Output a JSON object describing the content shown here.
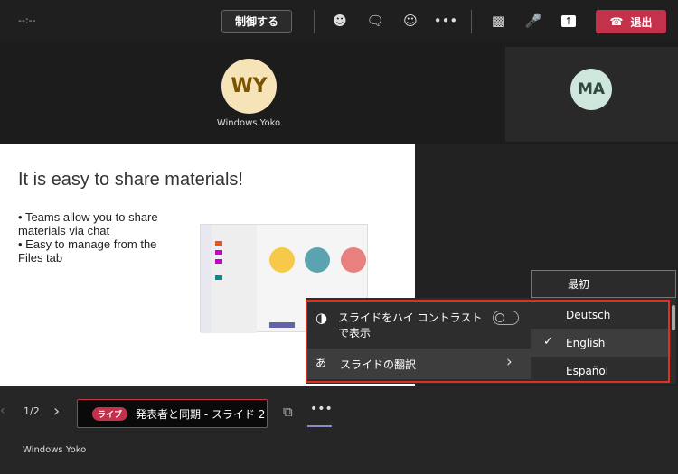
{
  "topbar": {
    "timer": "--:--",
    "control_label": "制御する",
    "leave_label": "退出",
    "accent": "#c4314b"
  },
  "participants": [
    {
      "initials": "WY",
      "name": "Windows Yoko",
      "color": "#f6e3b8",
      "text": "#7a5200"
    },
    {
      "initials": "MA",
      "color": "#cfe6dc",
      "text": "#2d4a3d"
    }
  ],
  "slide": {
    "title": "It is easy to share materials!",
    "bullets": [
      "Teams allow you to share materials via chat",
      "Easy to manage from the Files tab"
    ]
  },
  "menu": {
    "high_contrast_label": "スライドをハイ コントラストで表示",
    "high_contrast_on": false,
    "translate_label": "スライドの翻訳"
  },
  "languages": {
    "first": "最初",
    "items": [
      "Deutsch",
      "English",
      "Español"
    ],
    "selected": "English"
  },
  "bottom": {
    "page": "1/2",
    "live_badge": "ライブ",
    "sync_label": "発表者と同期 - スライド 2",
    "presenter": "Windows Yoko"
  }
}
